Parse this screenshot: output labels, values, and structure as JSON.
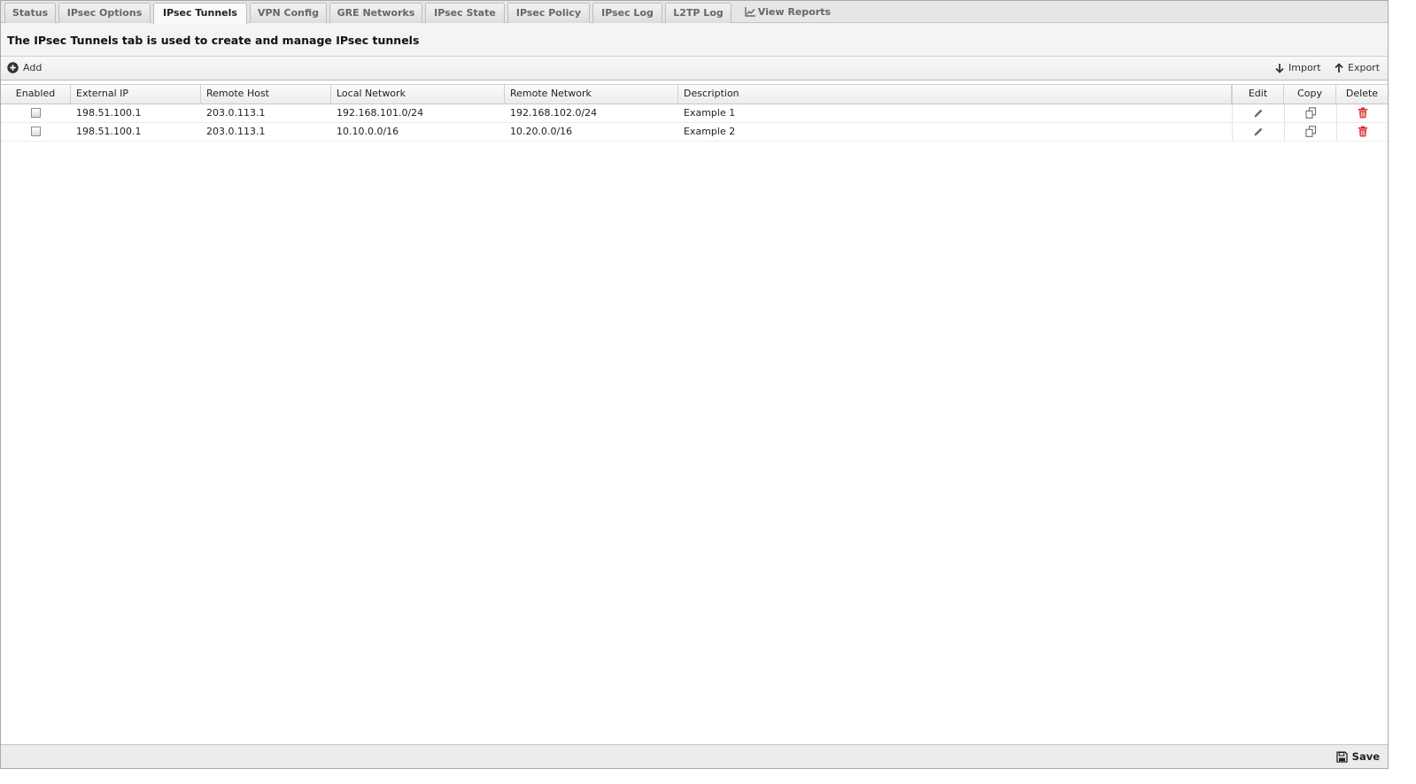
{
  "tabs": [
    {
      "label": "Status",
      "active": false
    },
    {
      "label": "IPsec Options",
      "active": false
    },
    {
      "label": "IPsec Tunnels",
      "active": true
    },
    {
      "label": "VPN Config",
      "active": false
    },
    {
      "label": "GRE Networks",
      "active": false
    },
    {
      "label": "IPsec State",
      "active": false
    },
    {
      "label": "IPsec Policy",
      "active": false
    },
    {
      "label": "IPsec Log",
      "active": false
    },
    {
      "label": "L2TP Log",
      "active": false
    },
    {
      "label": "View Reports",
      "active": false,
      "icon": "line-chart-icon"
    }
  ],
  "header": {
    "title": "The IPsec Tunnels tab is used to create and manage IPsec tunnels"
  },
  "toolbar": {
    "add_label": "Add",
    "add_icon": "plus-circle-icon",
    "import_label": "Import",
    "import_icon": "arrow-down-icon",
    "export_label": "Export",
    "export_icon": "arrow-up-icon"
  },
  "table": {
    "columns": [
      "Enabled",
      "External IP",
      "Remote Host",
      "Local Network",
      "Remote Network",
      "Description",
      "Edit",
      "Copy",
      "Delete"
    ],
    "rows": [
      {
        "enabled": false,
        "external_ip": "198.51.100.1",
        "remote_host": "203.0.113.1",
        "local_network": "192.168.101.0/24",
        "remote_network": "192.168.102.0/24",
        "description": "Example 1"
      },
      {
        "enabled": false,
        "external_ip": "198.51.100.1",
        "remote_host": "203.0.113.1",
        "local_network": "10.10.0.0/16",
        "remote_network": "10.20.0.0/16",
        "description": "Example 2"
      }
    ],
    "action_icons": {
      "edit": "pencil-icon",
      "copy": "copy-icon",
      "delete": "trash-icon"
    }
  },
  "footer": {
    "save_label": "Save",
    "save_icon": "floppy-disk-icon"
  },
  "colors": {
    "delete_icon": "#d9262b",
    "action_icon": "#6b6b6b"
  }
}
